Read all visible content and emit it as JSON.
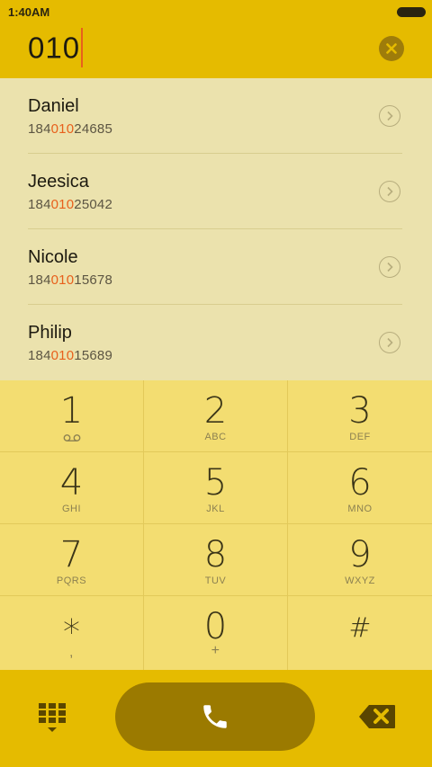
{
  "status_bar": {
    "time": "1:40AM"
  },
  "search": {
    "query": "010"
  },
  "contacts": [
    {
      "name": "Daniel",
      "number_prefix": "184",
      "number_match": "010",
      "number_suffix": "24685"
    },
    {
      "name": "Jeesica",
      "number_prefix": "184",
      "number_match": "010",
      "number_suffix": "25042"
    },
    {
      "name": "Nicole",
      "number_prefix": "184",
      "number_match": "010",
      "number_suffix": "15678"
    },
    {
      "name": "Philip",
      "number_prefix": "184",
      "number_match": "010",
      "number_suffix": "15689"
    }
  ],
  "keypad": [
    {
      "digit": "1",
      "sub": ""
    },
    {
      "digit": "2",
      "sub": "ABC"
    },
    {
      "digit": "3",
      "sub": "DEF"
    },
    {
      "digit": "4",
      "sub": "GHI"
    },
    {
      "digit": "5",
      "sub": "JKL"
    },
    {
      "digit": "6",
      "sub": "MNO"
    },
    {
      "digit": "7",
      "sub": "PQRS"
    },
    {
      "digit": "8",
      "sub": "TUV"
    },
    {
      "digit": "9",
      "sub": "WXYZ"
    },
    {
      "digit": "*",
      "sub": ","
    },
    {
      "digit": "0",
      "sub": "+"
    },
    {
      "digit": "#",
      "sub": ""
    }
  ],
  "icons": {
    "clear": "close-circle-icon",
    "contact_detail": "chevron-right-circle-icon",
    "voicemail": "voicemail-icon",
    "dialpad_toggle": "dialpad-icon",
    "call": "phone-icon",
    "backspace": "backspace-icon"
  },
  "colors": {
    "accent": "#e5bb00",
    "highlight": "#e8601c",
    "call_button": "#9b7a00",
    "results_bg": "#ebe2ad",
    "keypad_bg": "#f3dd71"
  }
}
